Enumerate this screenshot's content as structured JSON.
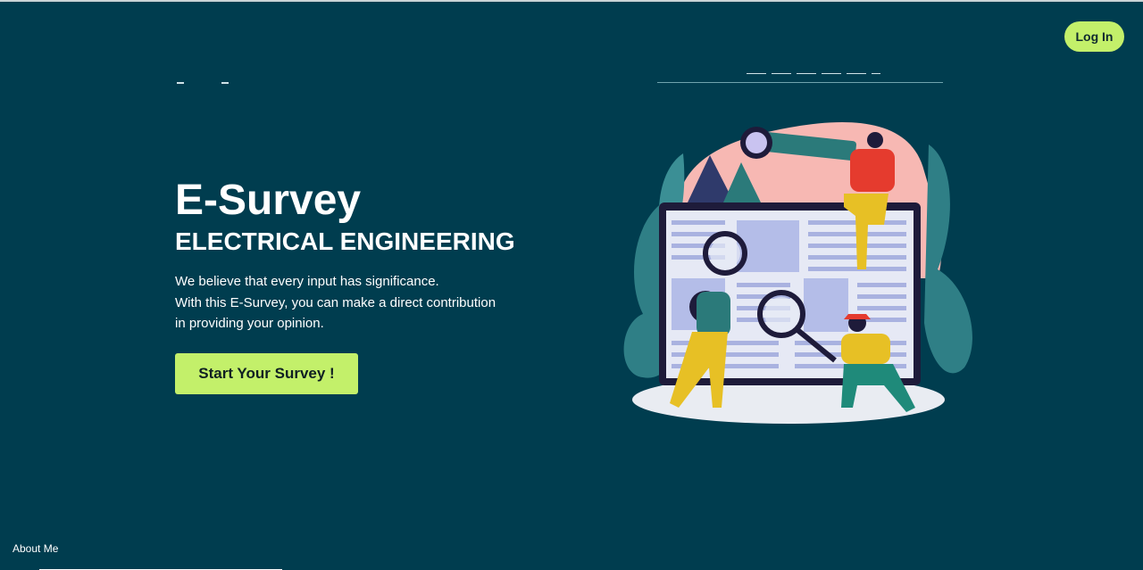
{
  "header": {
    "login_label": "Log In"
  },
  "hero": {
    "title": "E-Survey",
    "subtitle": "ELECTRICAL ENGINEERING",
    "description_lines": [
      "We believe that every input has significance.",
      "With this E-Survey, you can make a direct contribution",
      "in providing your opinion."
    ],
    "cta_label": "Start Your Survey !"
  },
  "footer": {
    "about_label": "About Me"
  },
  "colors": {
    "background": "#003d4f",
    "accent": "#c3f06a",
    "text": "#ffffff"
  },
  "illustration": {
    "icon": "survey-research-illustration"
  }
}
